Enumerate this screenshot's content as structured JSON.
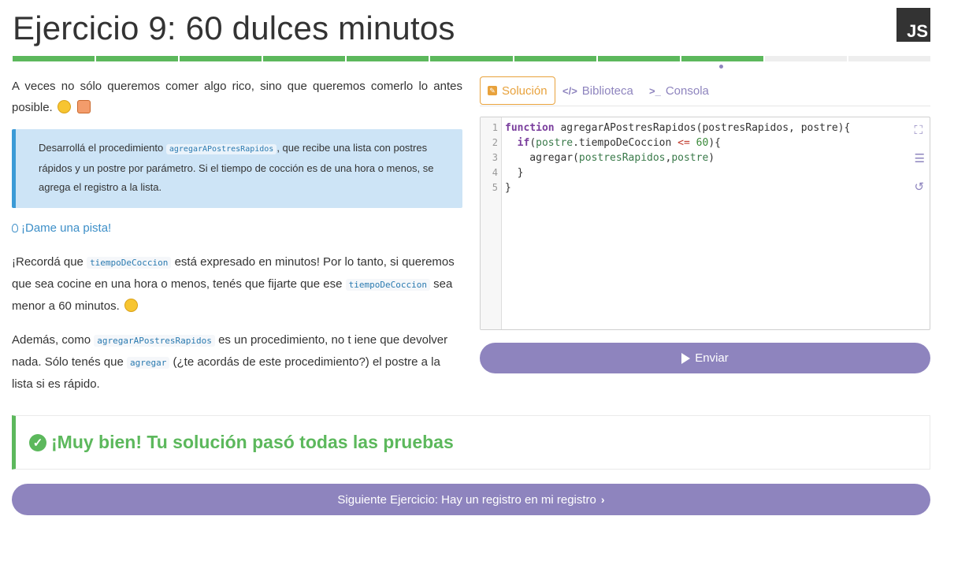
{
  "header": {
    "title": "Ejercicio 9: 60 dulces minutos",
    "language_badge": "JS",
    "progress": {
      "total_steps": 11,
      "completed_steps": 9
    }
  },
  "statement": {
    "intro": "A veces no sólo queremos comer algo rico, sino que queremos comerlo lo antes posible.",
    "intro_emojis": [
      "yum-face-emoji",
      "cake-emoji"
    ],
    "callout": {
      "before": "Desarrollá el procedimiento",
      "code": "agregarAPostresRapidos",
      "after": ", que recibe una lista con postres rápidos y un postre por parámetro. Si el tiempo de cocción es de una hora o menos, se agrega el registro a la lista."
    },
    "hint_label": "¡Dame una pista!",
    "hint_para1": {
      "a": "¡Recordá que",
      "code1": "tiempoDeCoccion",
      "b": "está expresado en minutos! Por lo tanto, si queremos que sea cocine en una hora o menos, tenés que fijarte que ese",
      "code2": "tiempoDeCoccion",
      "c": "sea menor a 60 minutos."
    },
    "hint_para2": {
      "a": "Además, como",
      "code1": "agregarAPostresRapidos",
      "b": "es un procedimiento, no t iene que devolver nada. Sólo tenés que",
      "code2": "agregar",
      "c": "(¿te acordás de este procedimiento?) el postre a la lista si es rápido."
    }
  },
  "tabs": [
    {
      "label": "Solución",
      "icon": "edit-icon",
      "active": true
    },
    {
      "label": "Biblioteca",
      "icon": "code-icon",
      "active": false
    },
    {
      "label": "Consola",
      "icon": "terminal-icon",
      "active": false
    }
  ],
  "editor": {
    "line_numbers": [
      "1",
      "2",
      "3",
      "4",
      "5"
    ],
    "code": {
      "l1_kw": "function",
      "l1_rest": " agregarAPostresRapidos(postresRapidos, postre){",
      "l2_pre": "  ",
      "l2_kw": "if",
      "l2_a": "(",
      "l2_var": "postre",
      "l2_b": ".tiempoDeCoccion ",
      "l2_op": "<=",
      "l2_sp": " ",
      "l2_num": "60",
      "l2_c": "){",
      "l3_pre": "    agregar(",
      "l3_var1": "postresRapidos",
      "l3_comma": ",",
      "l3_var2": "postre",
      "l3_end": ")",
      "l4": "  }",
      "l5": "}"
    },
    "tools": [
      "fullscreen-icon",
      "indent-icon",
      "reset-icon"
    ]
  },
  "submit_label": "Enviar",
  "result": {
    "message": "¡Muy bien! Tu solución pasó todas las pruebas"
  },
  "next_button_label": "Siguiente Ejercicio: Hay un registro en mi registro",
  "colors": {
    "accent": "#8e84be",
    "success": "#5cb85c",
    "active_tab": "#e8a23c",
    "callout_bg": "#cde4f6",
    "callout_border": "#3b9ad6"
  }
}
